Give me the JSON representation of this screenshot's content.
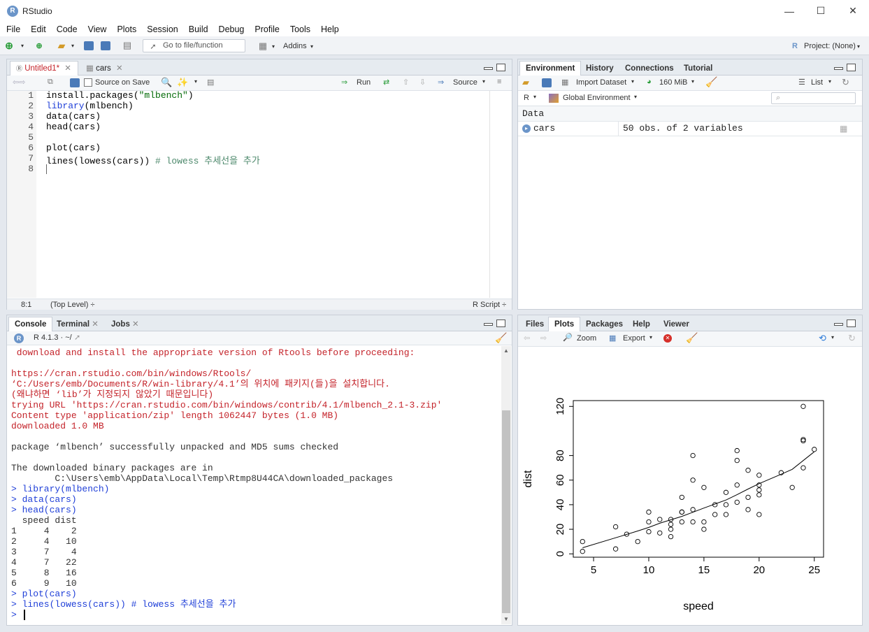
{
  "window": {
    "title": "RStudio",
    "minimize": "—",
    "maximize": "☐",
    "close": "✕"
  },
  "menu": [
    "File",
    "Edit",
    "Code",
    "View",
    "Plots",
    "Session",
    "Build",
    "Debug",
    "Profile",
    "Tools",
    "Help"
  ],
  "toolbar": {
    "goto_placeholder": "Go to file/function",
    "addins": "Addins",
    "project": "Project: (None)"
  },
  "source_pane": {
    "tabs": [
      {
        "label": "Untitled1*",
        "active": true
      },
      {
        "label": "cars",
        "active": false
      }
    ],
    "source_on_save": "Source on Save",
    "run": "Run",
    "source": "Source",
    "lines": [
      {
        "n": "1",
        "code": "install.packages(\"mlbench\")"
      },
      {
        "n": "2",
        "code": "library(mlbench)"
      },
      {
        "n": "3",
        "code": "data(cars)"
      },
      {
        "n": "4",
        "code": "head(cars)"
      },
      {
        "n": "5",
        "code": ""
      },
      {
        "n": "6",
        "code": "plot(cars)"
      },
      {
        "n": "7",
        "code": "lines(lowess(cars)) # lowess 추세선을 추가"
      },
      {
        "n": "8",
        "code": ""
      }
    ],
    "status_pos": "8:1",
    "status_scope": "(Top Level) ÷",
    "status_type": "R Script ÷"
  },
  "env_pane": {
    "tabs": [
      "Environment",
      "History",
      "Connections",
      "Tutorial"
    ],
    "import_dataset": "Import Dataset",
    "memory": "160 MiB",
    "view_mode": "List",
    "lang": "R",
    "scope": "Global Environment",
    "section": "Data",
    "rows": [
      {
        "name": "cars",
        "value": "50 obs. of 2 variables"
      }
    ]
  },
  "console_pane": {
    "tabs": [
      "Console",
      "Terminal",
      "Jobs"
    ],
    "r_version": "R 4.1.3 · ~/",
    "lines": [
      {
        "t": " download and install the appropriate version of Rtools before proceeding:",
        "c": "#c4232a"
      },
      {
        "t": "",
        "c": "#000"
      },
      {
        "t": "https://cran.rstudio.com/bin/windows/Rtools/",
        "c": "#c4232a"
      },
      {
        "t": "‘C:/Users/emb/Documents/R/win-library/4.1’의 위치에 패키지(들)을 설치합니다.",
        "c": "#c4232a"
      },
      {
        "t": "(왜냐하면 ‘lib’가 지정되지 않았기 때문입니다)",
        "c": "#c4232a"
      },
      {
        "t": "trying URL 'https://cran.rstudio.com/bin/windows/contrib/4.1/mlbench_2.1-3.zip'",
        "c": "#c4232a"
      },
      {
        "t": "Content type 'application/zip' length 1062447 bytes (1.0 MB)",
        "c": "#c4232a"
      },
      {
        "t": "downloaded 1.0 MB",
        "c": "#c4232a"
      },
      {
        "t": "",
        "c": "#000"
      },
      {
        "t": "package ‘mlbench’ successfully unpacked and MD5 sums checked",
        "c": "#333"
      },
      {
        "t": "",
        "c": "#000"
      },
      {
        "t": "The downloaded binary packages are in",
        "c": "#333"
      },
      {
        "t": "        C:\\Users\\emb\\AppData\\Local\\Temp\\Rtmp8U44CA\\downloaded_packages",
        "c": "#333"
      },
      {
        "t": "> library(mlbench)",
        "c": "#1f3fd8"
      },
      {
        "t": "> data(cars)",
        "c": "#1f3fd8"
      },
      {
        "t": "> head(cars)",
        "c": "#1f3fd8"
      },
      {
        "t": "  speed dist",
        "c": "#333"
      },
      {
        "t": "1     4    2",
        "c": "#333"
      },
      {
        "t": "2     4   10",
        "c": "#333"
      },
      {
        "t": "3     7    4",
        "c": "#333"
      },
      {
        "t": "4     7   22",
        "c": "#333"
      },
      {
        "t": "5     8   16",
        "c": "#333"
      },
      {
        "t": "6     9   10",
        "c": "#333"
      },
      {
        "t": "> plot(cars)",
        "c": "#1f3fd8"
      },
      {
        "t": "> lines(lowess(cars)) # lowess 추세선을 추가",
        "c": "#1f3fd8"
      },
      {
        "t": "> ",
        "c": "#1f3fd8"
      }
    ]
  },
  "files_pane": {
    "tabs": [
      "Files",
      "Plots",
      "Packages",
      "Help",
      "Viewer"
    ],
    "zoom": "Zoom",
    "export": "Export"
  },
  "chart_data": {
    "type": "scatter",
    "xlabel": "speed",
    "ylabel": "dist",
    "xlim": [
      4,
      25
    ],
    "ylim": [
      2,
      120
    ],
    "xticks": [
      5,
      10,
      15,
      20,
      25
    ],
    "yticks": [
      0,
      20,
      40,
      60,
      80,
      120
    ],
    "points": [
      [
        4,
        2
      ],
      [
        4,
        10
      ],
      [
        7,
        4
      ],
      [
        7,
        22
      ],
      [
        8,
        16
      ],
      [
        9,
        10
      ],
      [
        10,
        18
      ],
      [
        10,
        26
      ],
      [
        10,
        34
      ],
      [
        11,
        17
      ],
      [
        11,
        28
      ],
      [
        12,
        14
      ],
      [
        12,
        20
      ],
      [
        12,
        24
      ],
      [
        12,
        28
      ],
      [
        13,
        26
      ],
      [
        13,
        34
      ],
      [
        13,
        34
      ],
      [
        13,
        46
      ],
      [
        14,
        26
      ],
      [
        14,
        36
      ],
      [
        14,
        60
      ],
      [
        14,
        80
      ],
      [
        15,
        20
      ],
      [
        15,
        26
      ],
      [
        15,
        54
      ],
      [
        16,
        32
      ],
      [
        16,
        40
      ],
      [
        17,
        32
      ],
      [
        17,
        40
      ],
      [
        17,
        50
      ],
      [
        18,
        42
      ],
      [
        18,
        56
      ],
      [
        18,
        76
      ],
      [
        18,
        84
      ],
      [
        19,
        36
      ],
      [
        19,
        46
      ],
      [
        19,
        68
      ],
      [
        20,
        32
      ],
      [
        20,
        48
      ],
      [
        20,
        52
      ],
      [
        20,
        56
      ],
      [
        20,
        64
      ],
      [
        22,
        66
      ],
      [
        23,
        54
      ],
      [
        24,
        70
      ],
      [
        24,
        92
      ],
      [
        24,
        93
      ],
      [
        24,
        120
      ],
      [
        25,
        85
      ]
    ],
    "lowess": [
      [
        4,
        4.97
      ],
      [
        7,
        13.12
      ],
      [
        8,
        15.81
      ],
      [
        9,
        18.61
      ],
      [
        10,
        21.51
      ],
      [
        11,
        24.92
      ],
      [
        12,
        27.72
      ],
      [
        13,
        30.48
      ],
      [
        14,
        33.88
      ],
      [
        15,
        37.29
      ],
      [
        16,
        40.58
      ],
      [
        17,
        43.8
      ],
      [
        18,
        48.13
      ],
      [
        19,
        52.75
      ],
      [
        20,
        57.13
      ],
      [
        22,
        64.83
      ],
      [
        23,
        68.78
      ],
      [
        24,
        75.95
      ],
      [
        25,
        83.07
      ]
    ]
  }
}
